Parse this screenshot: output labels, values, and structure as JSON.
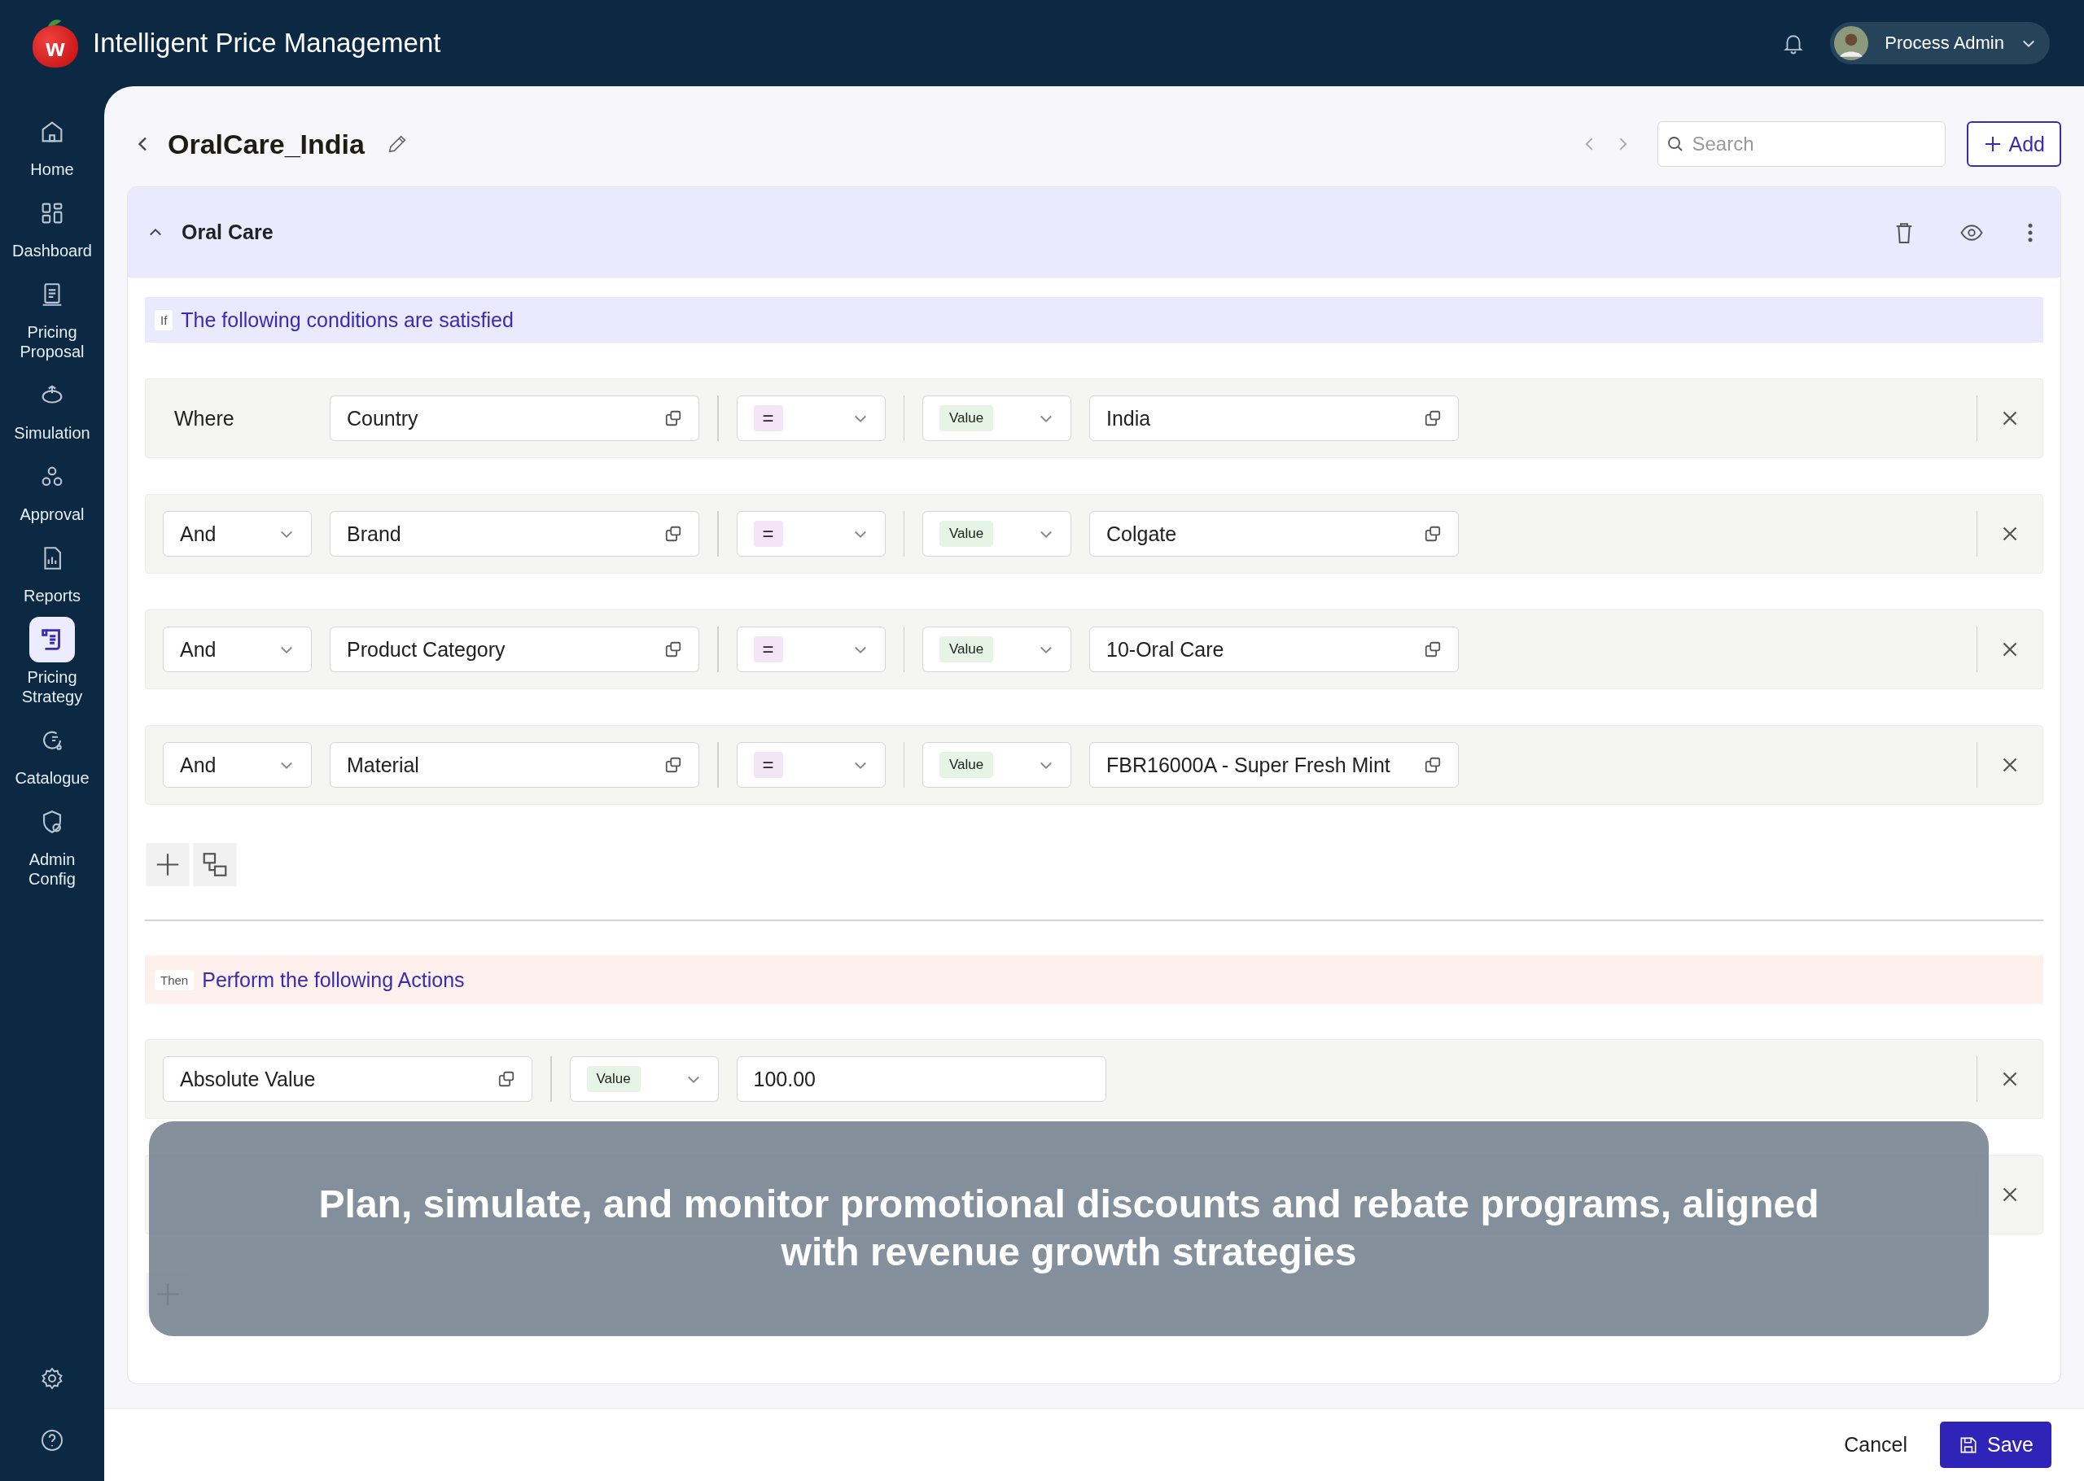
{
  "app": {
    "title": "Intelligent Price Management",
    "logo_letter": "w"
  },
  "user": {
    "name": "Process Admin"
  },
  "sidebar": {
    "items": [
      {
        "label": "Home",
        "selected": false
      },
      {
        "label": "Dashboard",
        "selected": false
      },
      {
        "label": "Pricing Proposal",
        "selected": false
      },
      {
        "label": "Simulation",
        "selected": false
      },
      {
        "label": "Approval",
        "selected": false
      },
      {
        "label": "Reports",
        "selected": false
      },
      {
        "label": "Pricing Strategy",
        "selected": true
      },
      {
        "label": "Catalogue",
        "selected": false
      },
      {
        "label": "Admin Config",
        "selected": false
      }
    ]
  },
  "page": {
    "title": "OralCare_India",
    "search": {
      "placeholder": "Search"
    },
    "add_button": "Add"
  },
  "group": {
    "title": "Oral Care",
    "expanded": true
  },
  "conditions_banner": {
    "tag": "If",
    "text": "The following conditions are satisfied"
  },
  "conditions": [
    {
      "connector": "Where",
      "kind": "label",
      "field": "Country",
      "operator": "=",
      "value_type": "Value",
      "value": "India"
    },
    {
      "connector": "And",
      "kind": "dropdown",
      "field": "Brand",
      "operator": "=",
      "value_type": "Value",
      "value": "Colgate"
    },
    {
      "connector": "And",
      "kind": "dropdown",
      "field": "Product Category",
      "operator": "=",
      "value_type": "Value",
      "value": "10-Oral Care"
    },
    {
      "connector": "And",
      "kind": "dropdown",
      "field": "Material",
      "operator": "=",
      "value_type": "Value",
      "value": "FBR16000A - Super Fresh Mint"
    }
  ],
  "actions_banner": {
    "tag": "Then",
    "text": "Perform the following Actions"
  },
  "actions": [
    {
      "field": "Absolute Value",
      "value_type": "Value",
      "value": "100.00",
      "removable": true
    },
    {
      "removable": true
    }
  ],
  "caption": {
    "text": "Plan, simulate, and monitor promotional discounts and rebate programs, aligned with revenue growth strategies"
  },
  "footer": {
    "cancel": "Cancel",
    "save": "Save"
  }
}
